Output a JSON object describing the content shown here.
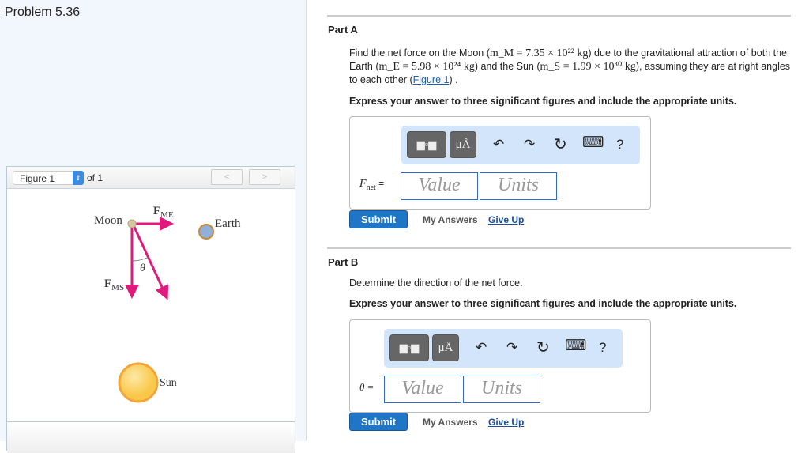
{
  "problem_title": "Problem 5.36",
  "figure": {
    "select_value": "Figure 1",
    "of_label": "of 1",
    "prev": "<",
    "next": ">",
    "labels": {
      "moon": "Moon",
      "earth": "Earth",
      "sun": "Sun",
      "f_me": "F",
      "f_me_sub": "ME",
      "f_ms": "F",
      "f_ms_sub": "MS",
      "theta": "θ"
    }
  },
  "part_a": {
    "heading": "Part A",
    "q1": "Find the net force on the Moon (",
    "mM": "m_M = 7.35 × 10²² kg",
    "q2": ") due to the gravitational attraction of both the Earth (",
    "mE": "m_E = 5.98 × 10²⁴ kg",
    "q3": ") and the Sun (",
    "mS": "m_S = 1.99 × 10³⁰ kg",
    "q4": "), assuming they are at right angles to each other (",
    "fig_link": "Figure 1",
    "q5": ") .",
    "instruction": "Express your answer to three significant figures and include the appropriate units.",
    "var_label": "F",
    "var_sub": "net",
    "eq": " =",
    "value_placeholder": "Value",
    "units_placeholder": "Units"
  },
  "part_b": {
    "heading": "Part B",
    "question": "Determine the direction of the net force.",
    "instruction": "Express your answer to three significant figures and include the appropriate units.",
    "var_label": "θ =",
    "value_placeholder": "Value",
    "units_placeholder": "Units"
  },
  "toolbar": {
    "units_btn": "μÅ",
    "undo": "↶",
    "redo": "↷",
    "reset": "↻",
    "keyboard": "⌨",
    "help": "?"
  },
  "actions": {
    "submit": "Submit",
    "my_answers": "My Answers",
    "give_up": "Give Up"
  }
}
